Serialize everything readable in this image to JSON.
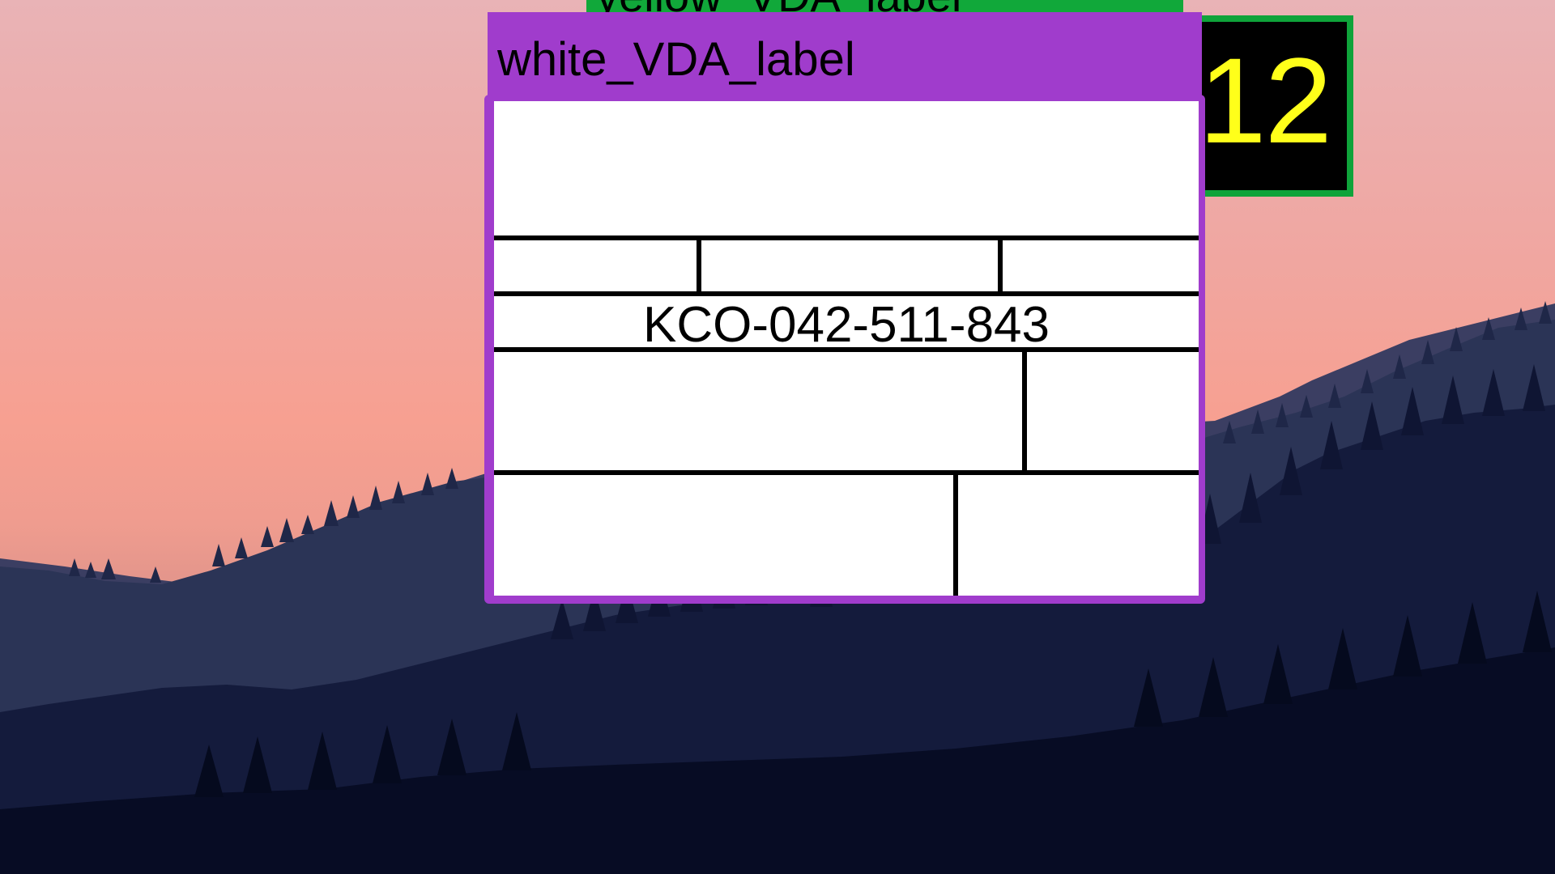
{
  "desktop": {
    "wallpaper": "sunset-mountain-forest",
    "colors": {
      "sky_top": "#e9b3b6",
      "sky_mid": "#f7a091",
      "mountain_back": "#2b3456",
      "forest_front": "#0c1330"
    }
  },
  "windows": {
    "yellow": {
      "title": "yellow_VDA_label",
      "accent": "#11a83a"
    },
    "badge": {
      "number": "12",
      "number_color": "#ffff1a",
      "frame_color": "#0fa33a"
    },
    "white": {
      "title": "white_VDA_label",
      "accent": "#a03ccc",
      "document_number": "KCO-042-511-843"
    }
  }
}
